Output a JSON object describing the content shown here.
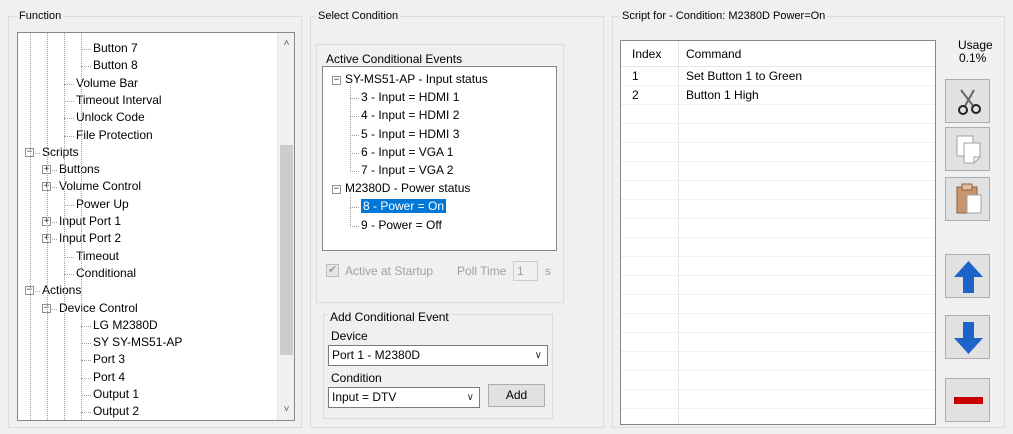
{
  "function_panel": {
    "title": "Function",
    "tree": [
      {
        "label": "Button 7",
        "depth": 3
      },
      {
        "label": "Button 8",
        "depth": 3
      },
      {
        "label": "Volume Bar",
        "depth": 2
      },
      {
        "label": "Timeout Interval",
        "depth": 2
      },
      {
        "label": "Unlock Code",
        "depth": 2
      },
      {
        "label": "File Protection",
        "depth": 2
      },
      {
        "label": "Scripts",
        "depth": 0,
        "expander": "-"
      },
      {
        "label": "Buttons",
        "depth": 1,
        "expander": "+"
      },
      {
        "label": "Volume Control",
        "depth": 1,
        "expander": "+"
      },
      {
        "label": "Power Up",
        "depth": 2
      },
      {
        "label": "Input Port 1",
        "depth": 1,
        "expander": "+"
      },
      {
        "label": "Input Port 2",
        "depth": 1,
        "expander": "+"
      },
      {
        "label": "Timeout",
        "depth": 2
      },
      {
        "label": "Conditional",
        "depth": 2
      },
      {
        "label": "Actions",
        "depth": 0,
        "expander": "-"
      },
      {
        "label": "Device Control",
        "depth": 1,
        "expander": "-"
      },
      {
        "label": "LG M2380D",
        "depth": 3
      },
      {
        "label": "SY SY-MS51-AP",
        "depth": 3
      },
      {
        "label": "Port 3",
        "depth": 3
      },
      {
        "label": "Port 4",
        "depth": 3
      },
      {
        "label": "Output 1",
        "depth": 3
      },
      {
        "label": "Output 2",
        "depth": 3
      }
    ]
  },
  "select_condition": {
    "title": "Select Condition",
    "active_events_label": "Active Conditional Events",
    "tree": [
      {
        "label": "SY-MS51-AP - Input status",
        "type": "group"
      },
      {
        "label": "3 - Input = HDMI 1",
        "type": "item"
      },
      {
        "label": "4 - Input = HDMI 2",
        "type": "item"
      },
      {
        "label": "5 - Input = HDMI 3",
        "type": "item"
      },
      {
        "label": "6 - Input = VGA 1",
        "type": "item"
      },
      {
        "label": "7 - Input = VGA 2",
        "type": "item"
      },
      {
        "label": "M2380D - Power status",
        "type": "group"
      },
      {
        "label": "8 - Power = On",
        "type": "item",
        "selected": true
      },
      {
        "label": "9 - Power = Off",
        "type": "item"
      }
    ],
    "active_at_startup_label": "Active at Startup",
    "active_at_startup_checked": true,
    "poll_time_label": "Poll Time",
    "poll_time_value": "1",
    "poll_time_unit": "s",
    "add_event": {
      "title": "Add Conditional Event",
      "device_label": "Device",
      "device_value": "Port 1 - M2380D",
      "condition_label": "Condition",
      "condition_value": "Input = DTV",
      "add_button": "Add"
    }
  },
  "script_panel": {
    "title": "Script for -  Condition: M2380D Power=On",
    "columns": [
      "Index",
      "Command"
    ],
    "rows": [
      {
        "index": "1",
        "command": "Set Button 1 to Green"
      },
      {
        "index": "2",
        "command": "Button 1 High"
      }
    ],
    "usage_label": "Usage",
    "usage_value": "0.1%"
  },
  "toolbar_icons": [
    "scissors-icon",
    "copy-icon",
    "paste-icon",
    "arrow-up-icon",
    "arrow-down-icon",
    "delete-icon"
  ],
  "colors": {
    "selection": "#0078d7",
    "arrow_blue": "#1e64c8",
    "delete_red": "#c80000"
  }
}
